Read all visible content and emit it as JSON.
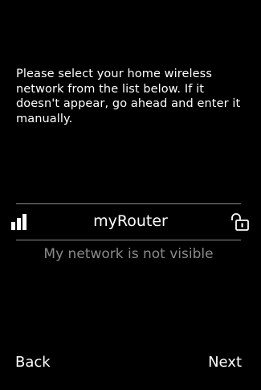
{
  "instructions": {
    "text": "Please select your home wireless network from the list below.  If it doesn't appear, go ahead and enter it manually."
  },
  "network_list": {
    "items": [
      {
        "name": "myRouter",
        "signal_icon": "signal-strength-icon",
        "security_icon": "lock-icon"
      }
    ]
  },
  "not_visible_label": "My network is not visible",
  "nav": {
    "back_label": "Back",
    "next_label": "Next"
  },
  "colors": {
    "background": "#000000",
    "text": "#ffffff",
    "muted": "#8a8a8a"
  }
}
